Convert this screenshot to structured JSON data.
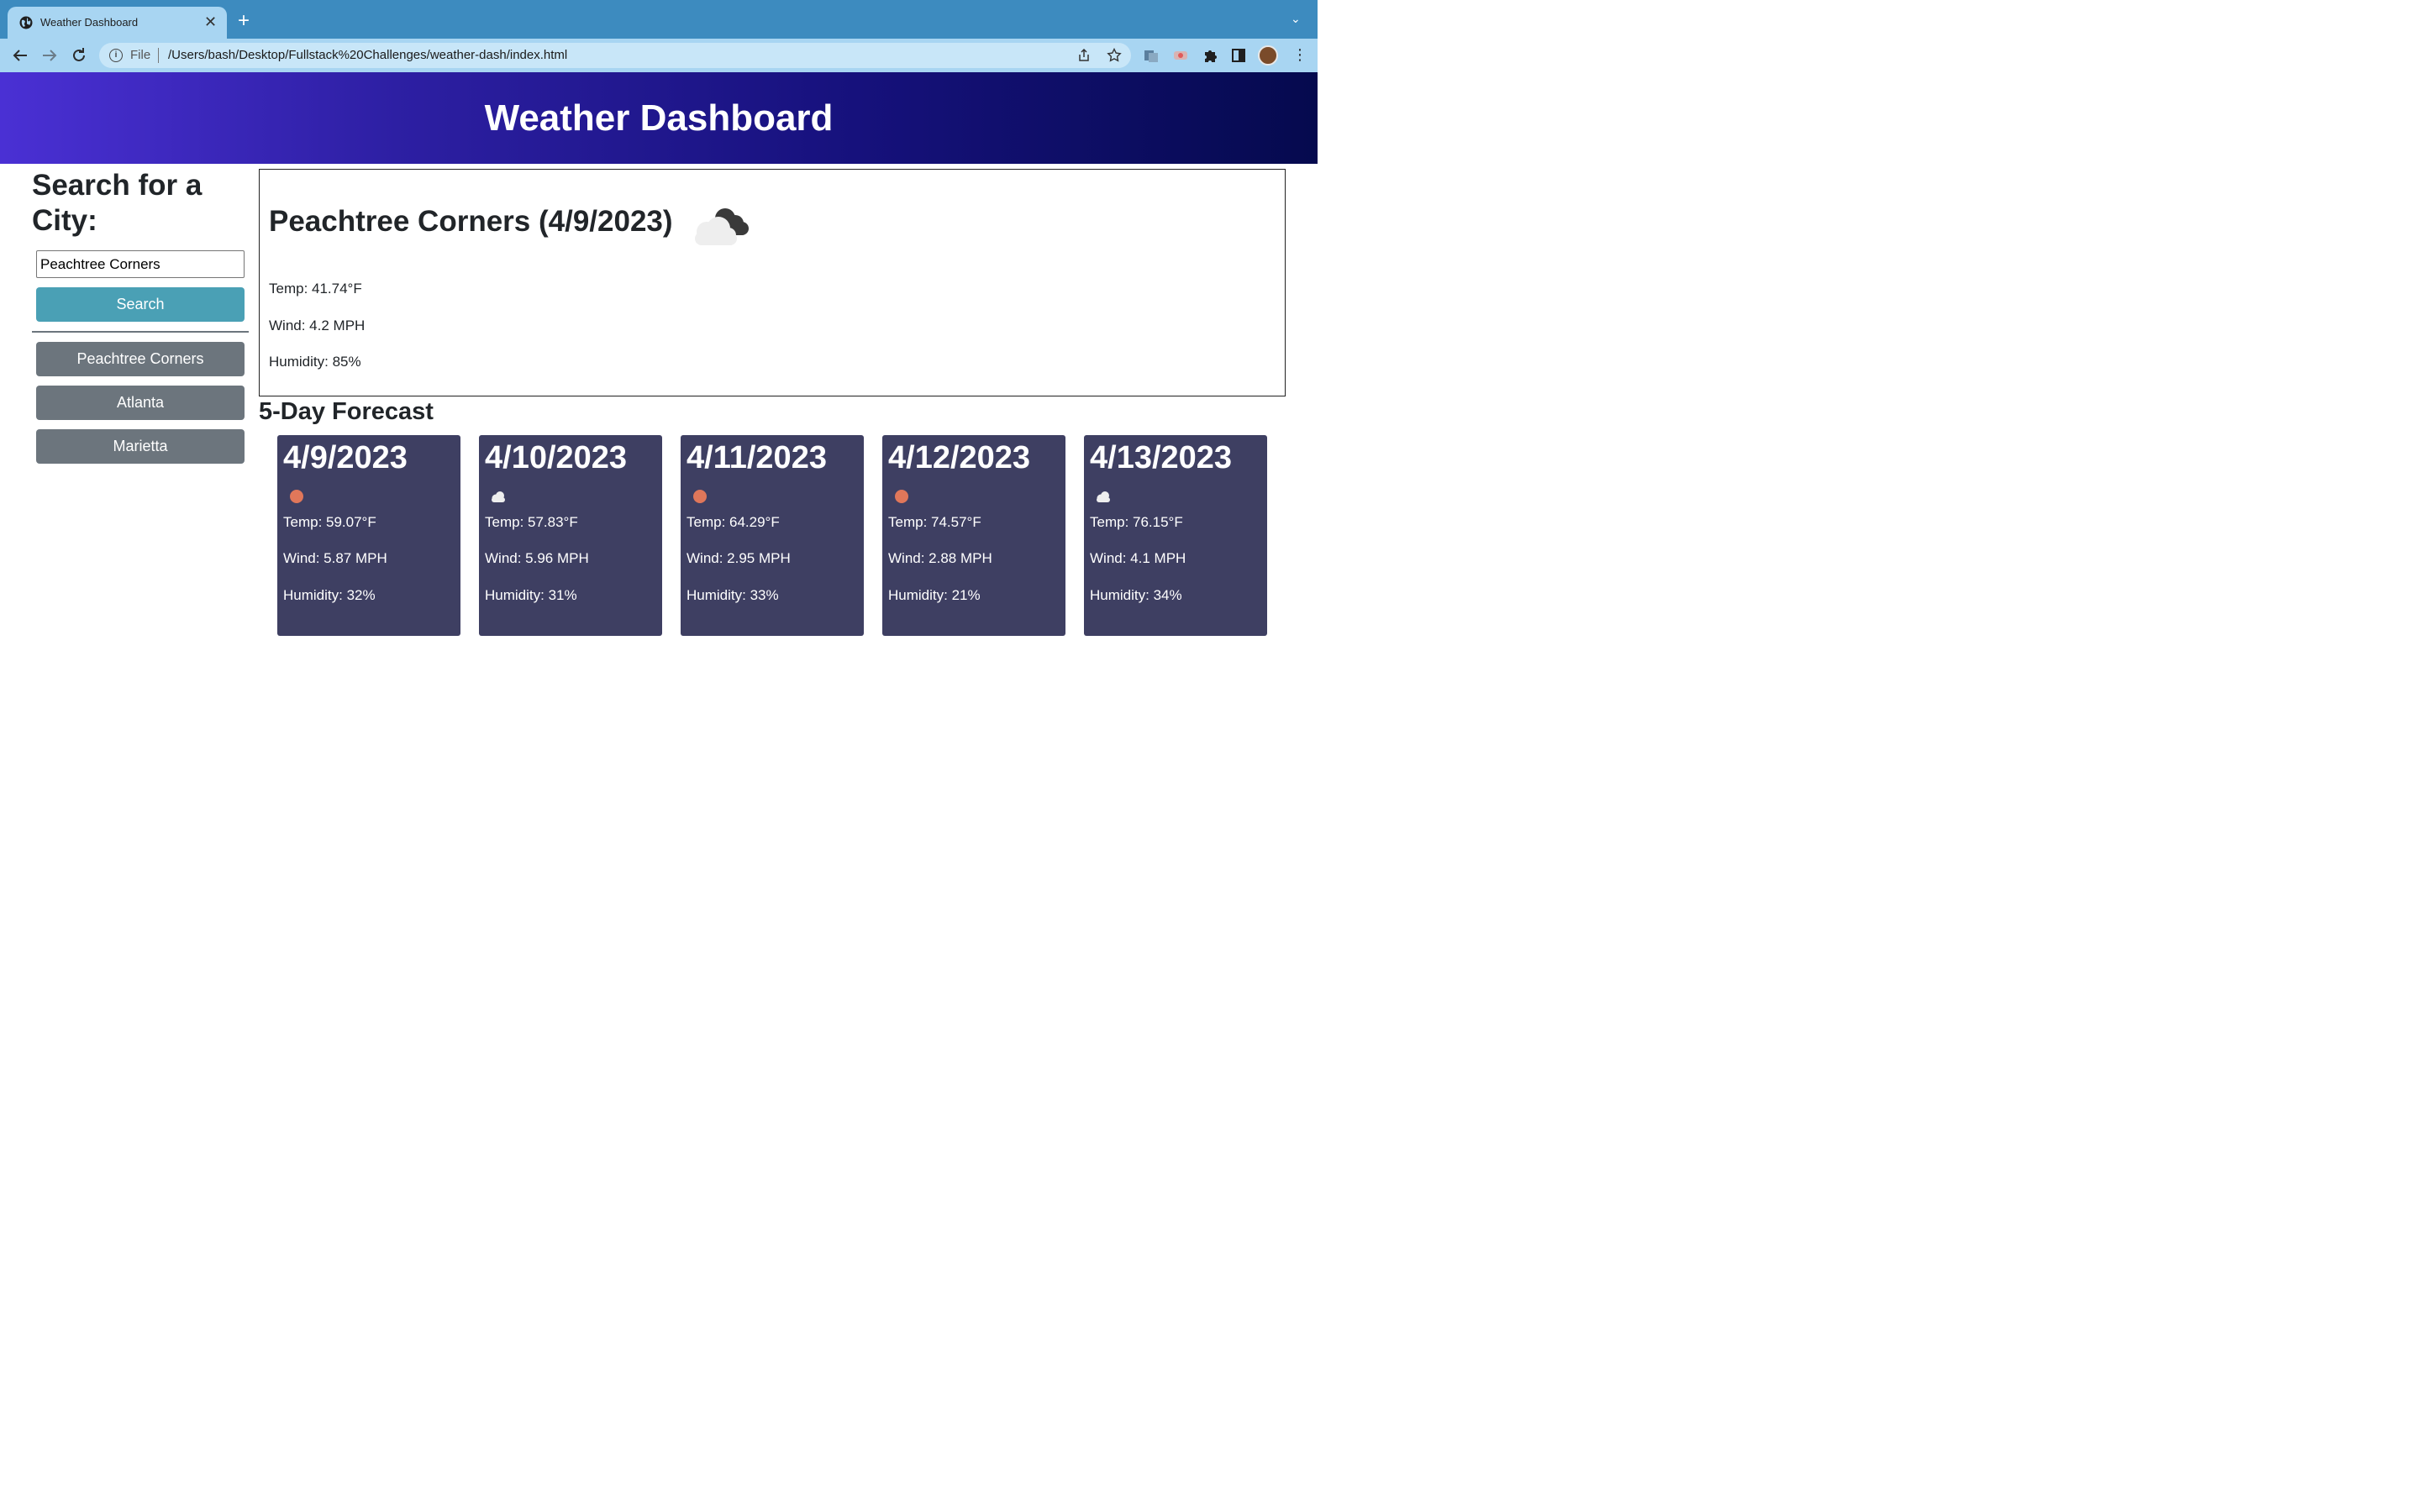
{
  "browser": {
    "tab_title": "Weather Dashboard",
    "close_glyph": "✕",
    "new_tab_glyph": "+",
    "tab_dropdown_glyph": "⌄",
    "scheme": "File",
    "url": "/Users/bash/Desktop/Fullstack%20Challenges/weather-dash/index.html"
  },
  "header": {
    "title": "Weather Dashboard"
  },
  "sidebar": {
    "heading": "Search for a City:",
    "input_value": "Peachtree Corners",
    "search_label": "Search",
    "history": [
      "Peachtree Corners",
      "Atlanta",
      "Marietta"
    ]
  },
  "current": {
    "title": "Peachtree Corners (4/9/2023)",
    "icon": "dark-cloud-icon",
    "temp": "Temp: 41.74°F",
    "wind": "Wind: 4.2 MPH",
    "humidity": "Humidity: 85%"
  },
  "forecast": {
    "title": "5-Day Forecast",
    "days": [
      {
        "date": "4/9/2023",
        "icon": "sun-icon",
        "temp": "Temp: 59.07°F",
        "wind": "Wind: 5.87 MPH",
        "humidity": "Humidity: 32%"
      },
      {
        "date": "4/10/2023",
        "icon": "cloud-icon",
        "temp": "Temp: 57.83°F",
        "wind": "Wind: 5.96 MPH",
        "humidity": "Humidity: 31%"
      },
      {
        "date": "4/11/2023",
        "icon": "sun-icon",
        "temp": "Temp: 64.29°F",
        "wind": "Wind: 2.95 MPH",
        "humidity": "Humidity: 33%"
      },
      {
        "date": "4/12/2023",
        "icon": "sun-icon",
        "temp": "Temp: 74.57°F",
        "wind": "Wind: 2.88 MPH",
        "humidity": "Humidity: 21%"
      },
      {
        "date": "4/13/2023",
        "icon": "cloud-icon",
        "temp": "Temp: 76.15°F",
        "wind": "Wind: 4.1 MPH",
        "humidity": "Humidity: 34%"
      }
    ]
  },
  "colors": {
    "card_bg": "#3e3f62",
    "search_button": "#4aa0b5",
    "history_button": "#6c757d",
    "sun": "#e0775a"
  }
}
